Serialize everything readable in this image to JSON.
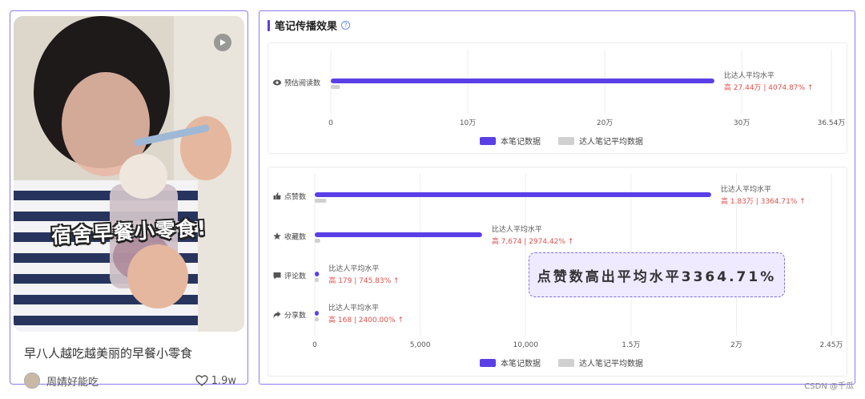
{
  "note": {
    "title": "早八人越吃越美丽的早餐小零食",
    "cover_caption": "宿舍早餐小零食!",
    "author": "周婧好能吃",
    "likes": "1.9w",
    "icons": {
      "play": "play-icon",
      "like": "heart-icon"
    }
  },
  "panel": {
    "title": "笔记传播效果",
    "help_icon": "question-circle-icon",
    "highlight_text": "点赞数高出平均水平3364.71%"
  },
  "legend": {
    "note_data": "本笔记数据",
    "avg_data": "达人笔记平均数据",
    "colors": {
      "note": "#5b3fe6",
      "avg": "#d0d0d0",
      "up": "#e0504a"
    }
  },
  "watermark": "CSDN @千瓜",
  "chart_data": [
    {
      "type": "bar",
      "orientation": "horizontal",
      "categories": [
        "预估阅读数"
      ],
      "category_icons": [
        "eye-icon"
      ],
      "series": [
        {
          "name": "本笔记数据",
          "values": [
            280000
          ]
        },
        {
          "name": "达人笔记平均数据",
          "values": [
            6700
          ]
        }
      ],
      "xlim": [
        0,
        365400
      ],
      "ticks": [
        0,
        100000,
        200000,
        300000,
        365400
      ],
      "tick_labels": [
        "0",
        "10万",
        "20万",
        "30万",
        "36.54万"
      ],
      "annotations": [
        {
          "label": "比达人平均水平",
          "detail": "高 27.44万 | 4074.87% ↑"
        }
      ],
      "grid": true,
      "legend_position": "bottom"
    },
    {
      "type": "bar",
      "orientation": "horizontal",
      "categories": [
        "点赞数",
        "收藏数",
        "评论数",
        "分享数"
      ],
      "category_icons": [
        "thumbs-up-icon",
        "star-icon",
        "comment-icon",
        "share-icon"
      ],
      "series": [
        {
          "name": "本笔记数据",
          "values": [
            18800,
            7932,
            203,
            175
          ]
        },
        {
          "name": "达人笔记平均数据",
          "values": [
            545,
            258,
            24,
            7
          ]
        }
      ],
      "xlim": [
        0,
        24500
      ],
      "ticks": [
        0,
        5000,
        10000,
        15000,
        20000,
        24500
      ],
      "tick_labels": [
        "0",
        "5,000",
        "10,000",
        "1.5万",
        "2万",
        "2.45万"
      ],
      "annotations": [
        {
          "label": "比达人平均水平",
          "detail": "高 1.83万 | 3364.71% ↑"
        },
        {
          "label": "比达人平均水平",
          "detail": "高 7,674 | 2974.42% ↑"
        },
        {
          "label": "比达人平均水平",
          "detail": "高 179 | 745.83% ↑"
        },
        {
          "label": "比达人平均水平",
          "detail": "高 168 | 2400.00% ↑"
        }
      ],
      "grid": true,
      "legend_position": "bottom"
    }
  ]
}
